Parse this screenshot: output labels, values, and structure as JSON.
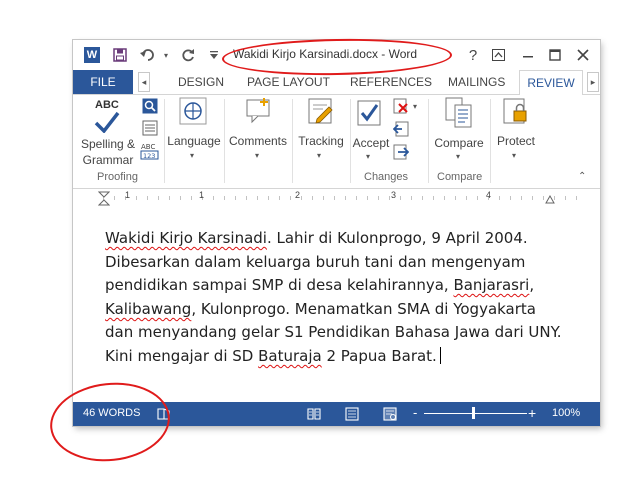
{
  "window": {
    "title": "Wakidi Kirjo Karsinadi.docx - Word",
    "icons": [
      "word-logo-icon",
      "save-icon",
      "undo-icon",
      "redo-icon",
      "customize-qat-icon",
      "help-icon",
      "ribbon-display-icon",
      "minimize-icon",
      "maximize-icon",
      "close-icon"
    ]
  },
  "tabs": {
    "file": "FILE",
    "items": [
      "DESIGN",
      "PAGE LAYOUT",
      "REFERENCES",
      "MAILINGS",
      "REVIEW"
    ],
    "active": "REVIEW"
  },
  "ribbon": {
    "proofing": {
      "spelling_line1": "Spelling &",
      "spelling_line2": "Grammar",
      "abc": "ABC",
      "group_label": "Proofing"
    },
    "language": {
      "label": "Language"
    },
    "comments": {
      "label": "Comments"
    },
    "tracking": {
      "label": "Tracking"
    },
    "changes": {
      "accept": "Accept",
      "group_label": "Changes"
    },
    "compare": {
      "compare": "Compare",
      "group_label": "Compare"
    },
    "protect": {
      "label": "Protect"
    }
  },
  "ruler": {
    "numbers": [
      "1",
      "1",
      "2",
      "3",
      "4"
    ]
  },
  "document": {
    "lines": [
      [
        "Wakidi Kirjo Karsinadi",
        ". Lahir di Kulonprogo, 9 April 2004."
      ],
      [
        "Dibesarkan dalam keluarga buruh tani dan mengenyam"
      ],
      [
        "pendidikan sampai SMP di desa kelahirannya, ",
        "Banjarasri",
        ","
      ],
      [
        "Kalibawang",
        ", Kulonprogo. Menamatkan SMA di Yogyakarta"
      ],
      [
        "dan menyandang gelar S1 Pendidikan Bahasa Jawa dari UNY."
      ],
      [
        "Kini mengajar di SD ",
        "Baturaja",
        " 2 Papua Barat."
      ]
    ]
  },
  "status": {
    "word_count": "46 WORDS",
    "zoom": "100%",
    "zoom_minus": "-",
    "zoom_plus": "+"
  },
  "colors": {
    "accent": "#2b579a",
    "annotation": "#e01b1b"
  }
}
